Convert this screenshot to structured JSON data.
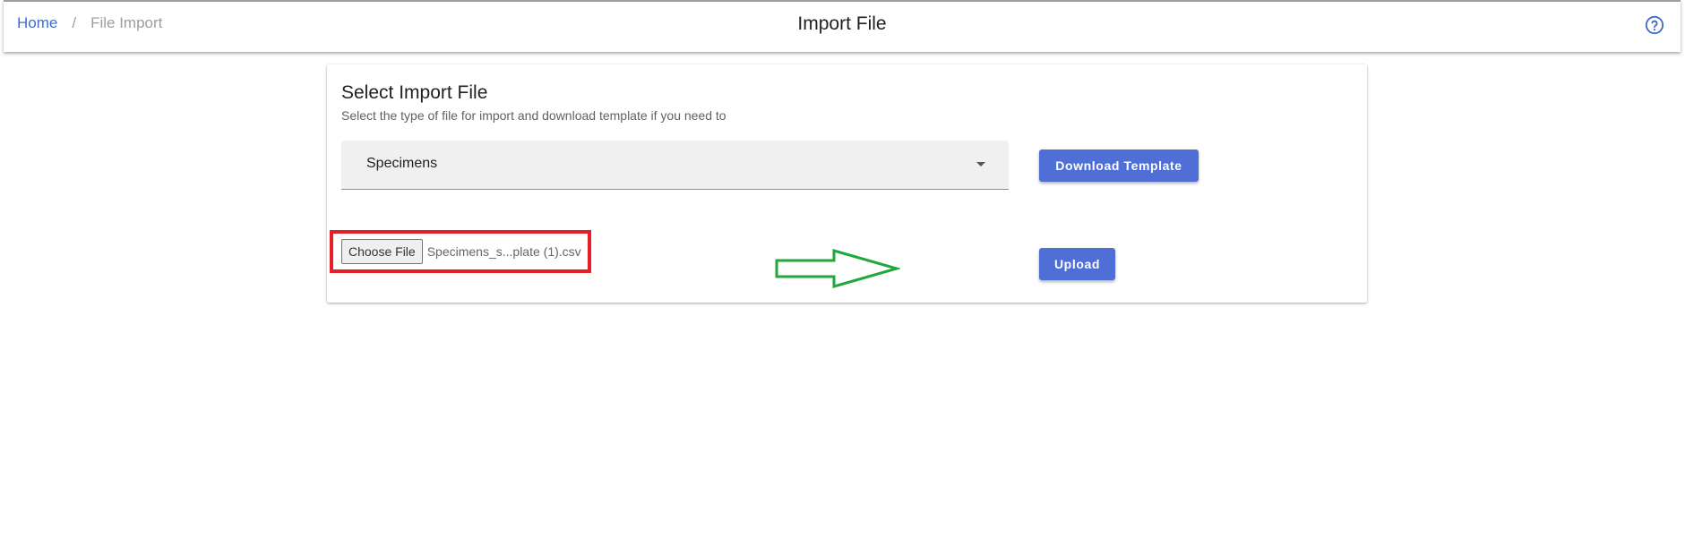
{
  "header": {
    "breadcrumb": {
      "home": "Home",
      "separator": "/",
      "current": "File Import"
    },
    "title": "Import File",
    "help_icon": "help-circle-icon"
  },
  "card": {
    "title": "Select Import File",
    "subtitle": "Select the type of file for import and download template if you need to",
    "file_type_select": {
      "selected": "Specimens"
    },
    "download_template_label": "Download Template",
    "file_input": {
      "button_label": "Choose File",
      "file_name": "Specimens_s...plate (1).csv"
    },
    "upload_label": "Upload"
  },
  "colors": {
    "accent": "#4f6fd6",
    "link": "#3f6cc9",
    "highlight_box": "#e32026",
    "arrow_annotation": "#1fa83a",
    "select_background": "#f0f0f0"
  }
}
